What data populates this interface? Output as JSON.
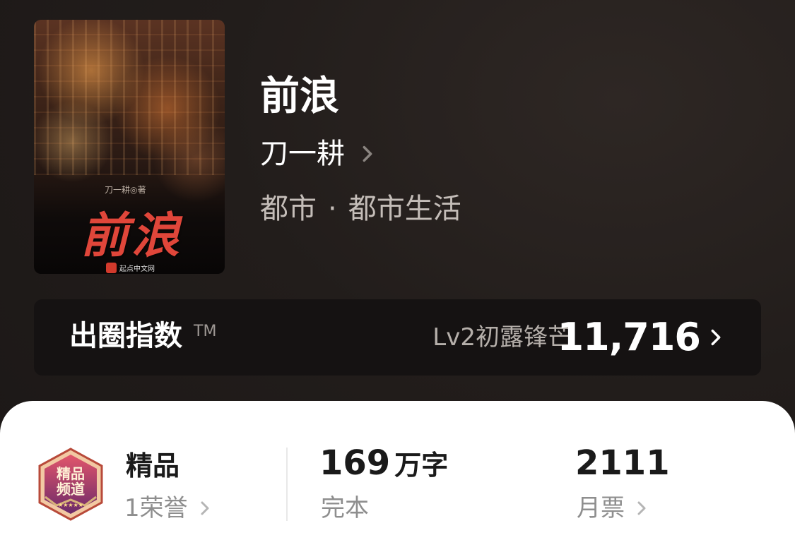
{
  "book": {
    "title": "前浪",
    "author": "刀一耕",
    "genre": "都市",
    "subgenre": "都市生活",
    "genre_separator": "·"
  },
  "cover": {
    "author_text": "刀一耕◎著",
    "title_text": "前浪",
    "publisher": "起点中文网"
  },
  "index": {
    "label": "出圈指数",
    "tm": "TM",
    "level": "Lv2初露锋芒",
    "score": "11,716"
  },
  "stats": {
    "premium_title": "精品",
    "honors": "1荣誉",
    "words_count": "169",
    "words_unit": "万字",
    "status": "完本",
    "monthly_votes": "2111",
    "votes_label": "月票"
  },
  "badge": {
    "text": "精品频道"
  },
  "colors": {
    "background": "#221d1b",
    "index_bar": "#151212",
    "card": "#ffffff",
    "cover_title_red": "#e0463a",
    "badge_purple": "#7a2a6e",
    "badge_red": "#c0392b"
  },
  "icons": {
    "author_chevron": "chevron-right-icon",
    "index_chevron": "chevron-right-icon",
    "honors_chevron": "chevron-right-icon",
    "votes_chevron": "chevron-right-icon",
    "premium_badge": "premium-channel-badge-icon"
  }
}
